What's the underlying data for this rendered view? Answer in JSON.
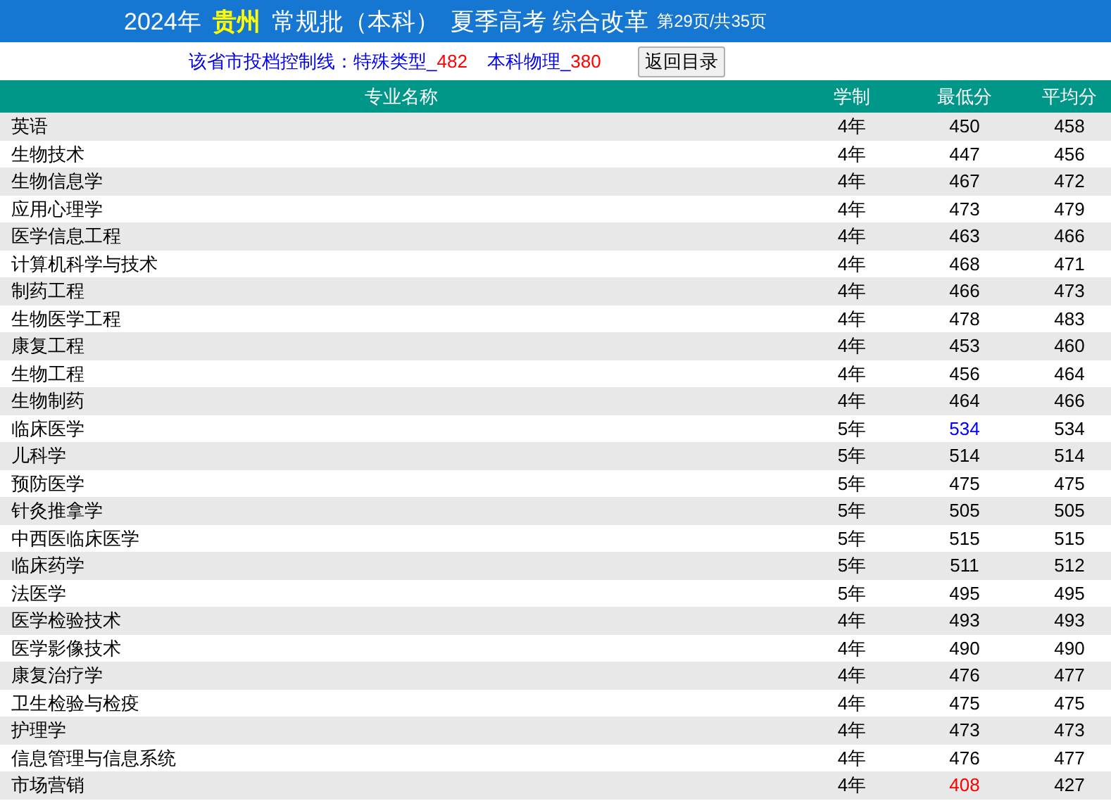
{
  "header": {
    "year": "2024年",
    "province": "贵州",
    "batch": "常规批（本科）",
    "exam": "夏季高考 综合改革",
    "page": "第29页/共35页"
  },
  "control_line": {
    "label": "该省市投档控制线：",
    "items": [
      {
        "name": "特殊类型_",
        "score": "482"
      },
      {
        "name": "本科物理_",
        "score": "380"
      }
    ]
  },
  "back_button": "返回目录",
  "table": {
    "columns": [
      "专业名称",
      "学制",
      "最低分",
      "平均分"
    ],
    "rows": [
      {
        "name": "英语",
        "years": "4年",
        "min": "450",
        "avg": "458",
        "color": "#000000"
      },
      {
        "name": "生物技术",
        "years": "4年",
        "min": "447",
        "avg": "456",
        "color": "#000000"
      },
      {
        "name": "生物信息学",
        "years": "4年",
        "min": "467",
        "avg": "472",
        "color": "#000000"
      },
      {
        "name": "应用心理学",
        "years": "4年",
        "min": "473",
        "avg": "479",
        "color": "#000000"
      },
      {
        "name": "医学信息工程",
        "years": "4年",
        "min": "463",
        "avg": "466",
        "color": "#000000"
      },
      {
        "name": "计算机科学与技术",
        "years": "4年",
        "min": "468",
        "avg": "471",
        "color": "#000000"
      },
      {
        "name": "制药工程",
        "years": "4年",
        "min": "466",
        "avg": "473",
        "color": "#000000"
      },
      {
        "name": "生物医学工程",
        "years": "4年",
        "min": "478",
        "avg": "483",
        "color": "#000000"
      },
      {
        "name": "康复工程",
        "years": "4年",
        "min": "453",
        "avg": "460",
        "color": "#000000"
      },
      {
        "name": "生物工程",
        "years": "4年",
        "min": "456",
        "avg": "464",
        "color": "#000000"
      },
      {
        "name": "生物制药",
        "years": "4年",
        "min": "464",
        "avg": "466",
        "color": "#000000"
      },
      {
        "name": "临床医学",
        "years": "5年",
        "min": "534",
        "avg": "534",
        "color": "#0000ff"
      },
      {
        "name": "儿科学",
        "years": "5年",
        "min": "514",
        "avg": "514",
        "color": "#000000"
      },
      {
        "name": "预防医学",
        "years": "5年",
        "min": "475",
        "avg": "475",
        "color": "#000000"
      },
      {
        "name": "针灸推拿学",
        "years": "5年",
        "min": "505",
        "avg": "505",
        "color": "#000000"
      },
      {
        "name": "中西医临床医学",
        "years": "5年",
        "min": "515",
        "avg": "515",
        "color": "#000000"
      },
      {
        "name": "临床药学",
        "years": "5年",
        "min": "511",
        "avg": "512",
        "color": "#000000"
      },
      {
        "name": "法医学",
        "years": "5年",
        "min": "495",
        "avg": "495",
        "color": "#000000"
      },
      {
        "name": "医学检验技术",
        "years": "4年",
        "min": "493",
        "avg": "493",
        "color": "#000000"
      },
      {
        "name": "医学影像技术",
        "years": "4年",
        "min": "490",
        "avg": "490",
        "color": "#000000"
      },
      {
        "name": "康复治疗学",
        "years": "4年",
        "min": "476",
        "avg": "477",
        "color": "#000000"
      },
      {
        "name": "卫生检验与检疫",
        "years": "4年",
        "min": "475",
        "avg": "475",
        "color": "#000000"
      },
      {
        "name": "护理学",
        "years": "4年",
        "min": "473",
        "avg": "473",
        "color": "#000000"
      },
      {
        "name": "信息管理与信息系统",
        "years": "4年",
        "min": "476",
        "avg": "477",
        "color": "#000000"
      },
      {
        "name": "市场营销",
        "years": "4年",
        "min": "408",
        "avg": "427",
        "color": "#ff0000"
      }
    ]
  }
}
